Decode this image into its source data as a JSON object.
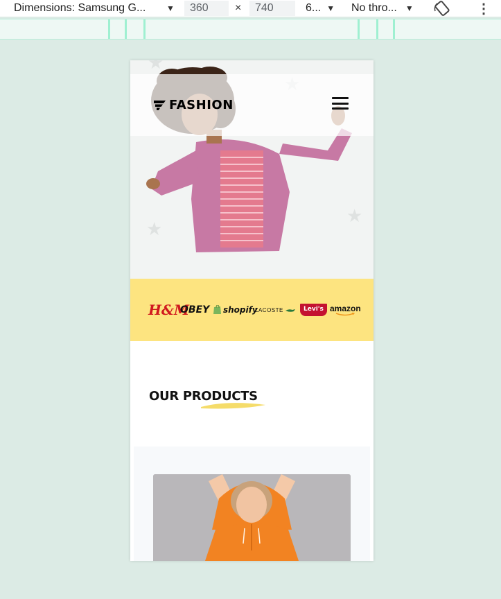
{
  "devtools": {
    "dimensions_label": "Dimensions: Samsung G...",
    "width_value": "360",
    "times_symbol": "×",
    "height_value": "740",
    "zoom_label": "6...",
    "throttle_label": "No thro...",
    "more_symbol": "⋮",
    "accent_color": "#9ff0d1"
  },
  "site": {
    "logo_text": "FASHION",
    "brands": [
      "H&M",
      "OBEY",
      "shopify",
      "LACOSTE",
      "Levi's",
      "amazon"
    ],
    "products_title": "OUR PRODUCTS",
    "colors": {
      "brand_strip": "#fde480",
      "hero_bg": "#f2f4f3",
      "hoodie": "#f28322"
    }
  }
}
